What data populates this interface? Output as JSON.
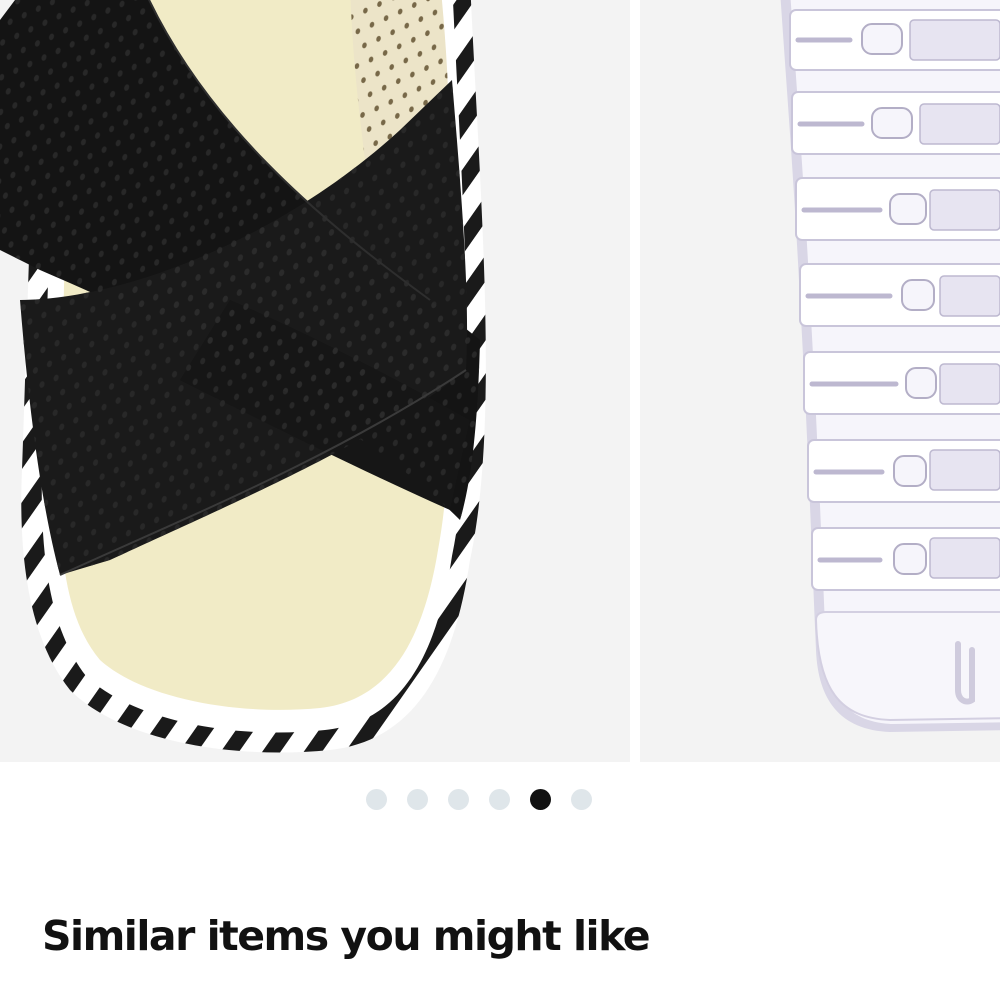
{
  "carousel": {
    "slides": [
      {
        "subject": "sandal-top-view"
      },
      {
        "subject": "sandal-sole-view"
      }
    ],
    "dot_count": 6,
    "active_index": 4,
    "colors": {
      "dot_inactive": "#dfe6ea",
      "dot_active": "#111111",
      "photo_background": "#f2f2f2"
    }
  },
  "similar_section": {
    "title": "Similar items you might like"
  }
}
